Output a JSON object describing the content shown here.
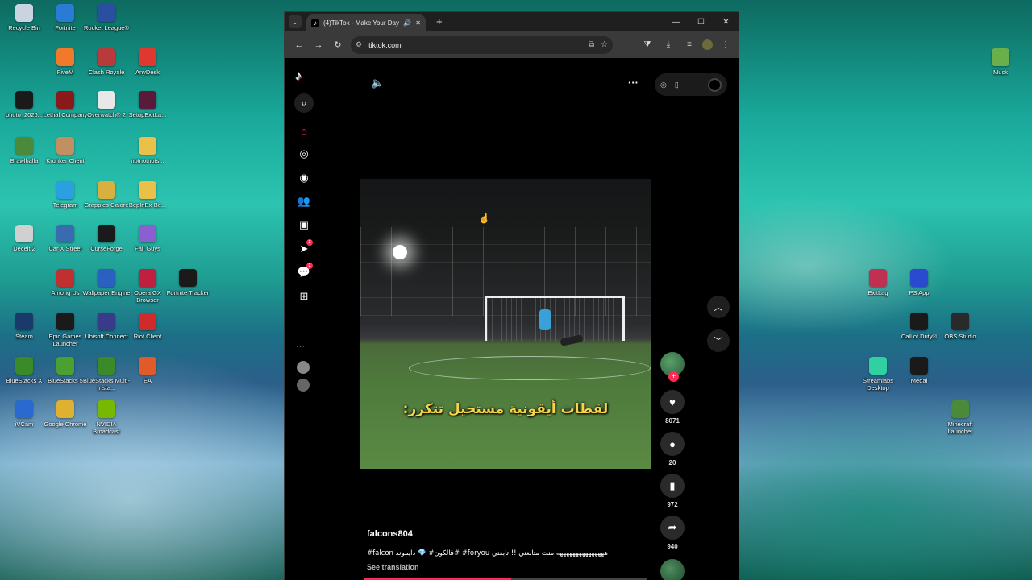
{
  "desktop_icons": [
    {
      "label": "Recycle Bin",
      "color": "#c8d4e0"
    },
    {
      "label": "Fortnite",
      "color": "#2a7bd4"
    },
    {
      "label": "Rocket League®",
      "color": "#2a4ea0"
    },
    {
      "label": "FiveM",
      "color": "#f07a2a"
    },
    {
      "label": "Clash Royale",
      "color": "#b83a3a"
    },
    {
      "label": "AnyDesk",
      "color": "#e0382e"
    },
    {
      "label": "photo_2026...",
      "color": "#1a1a1a"
    },
    {
      "label": "Lethal Company",
      "color": "#8a1a1a"
    },
    {
      "label": "Overwatch® 2",
      "color": "#e8e8e8"
    },
    {
      "label": "SetupExitLa...",
      "color": "#5a1a3a"
    },
    {
      "label": "Brawlhalla",
      "color": "#4a8a3a"
    },
    {
      "label": "Krunker Client",
      "color": "#c09060"
    },
    {
      "label": "notnotnots...",
      "color": "#e8c04a"
    },
    {
      "label": "Telegram",
      "color": "#2aa0e0"
    },
    {
      "label": "Grapples Galore",
      "color": "#d8b040"
    },
    {
      "label": "BepInEx-Be...",
      "color": "#e8c04a"
    },
    {
      "label": "Deceit 2",
      "color": "#d0d0d0"
    },
    {
      "label": "Car X Street",
      "color": "#3a6ab0"
    },
    {
      "label": "CurseForge",
      "color": "#1a1a1a"
    },
    {
      "label": "Fall Guys",
      "color": "#8a60d0"
    },
    {
      "label": "Among Us",
      "color": "#c03030"
    },
    {
      "label": "Wallpaper Engine",
      "color": "#2a60c0"
    },
    {
      "label": "Opera GX Browser",
      "color": "#c02040"
    },
    {
      "label": "Fortnite Tracker",
      "color": "#1a1a1a"
    },
    {
      "label": "Steam",
      "color": "#1a3a6a"
    },
    {
      "label": "Epic Games Launcher",
      "color": "#1a1a1a"
    },
    {
      "label": "Ubisoft Connect",
      "color": "#3a3a8a"
    },
    {
      "label": "Riot Client",
      "color": "#d02a2a"
    },
    {
      "label": "BlueStacks X",
      "color": "#3a8a2a"
    },
    {
      "label": "BlueStacks 5",
      "color": "#4aa030"
    },
    {
      "label": "BlueStacks Multi-Insta...",
      "color": "#3a8a2a"
    },
    {
      "label": "EA",
      "color": "#e05a2a"
    },
    {
      "label": "iVCam",
      "color": "#2a6ad0"
    },
    {
      "label": "Google Chrome",
      "color": "#e0b030"
    },
    {
      "label": "NVIDIA Broadcast",
      "color": "#76b900"
    },
    {
      "label": "Muck",
      "color": "#6ab04a"
    },
    {
      "label": "ExitLag",
      "color": "#c03050"
    },
    {
      "label": "PS App",
      "color": "#2a4ad0"
    },
    {
      "label": "Call of Duty®",
      "color": "#1a1a1a"
    },
    {
      "label": "OBS Studio",
      "color": "#2a2a2a"
    },
    {
      "label": "Streamlabs Desktop",
      "color": "#30d0a0"
    },
    {
      "label": "Medal",
      "color": "#1a1a1a"
    },
    {
      "label": "Minecraft Launcher",
      "color": "#4a8a3a"
    }
  ],
  "browser": {
    "tab_title": "(4)TikTok - Make Your Day",
    "url": "tiktok.com",
    "tab_close": "✕",
    "new_tab": "+",
    "min": "—",
    "max": "☐",
    "close": "✕"
  },
  "tiktok": {
    "logo": "♪",
    "nav_badges": {
      "inbox": "3",
      "messages": "1"
    },
    "more_dots": "···",
    "video_caption": "لقطات أيقونية مستحيل تتكرر:",
    "author": "falcons804",
    "description": "#falcon فالكون# 💎 دايموند# #foryou هههههههههههههههه منت متابعني !! تابعني",
    "see_translation": "See translation",
    "likes": "8071",
    "comments": "20",
    "saves": "972",
    "shares": "940",
    "progress": 0.52
  },
  "colors": {
    "accent": "#fe2c55",
    "caption": "#f5d44a"
  }
}
